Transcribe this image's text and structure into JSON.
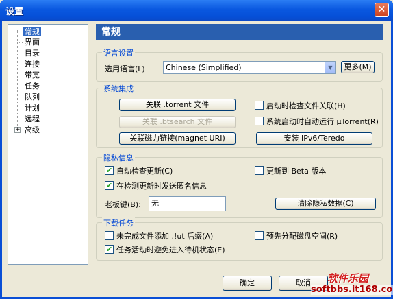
{
  "window": {
    "title": "设置",
    "close_glyph": "✕"
  },
  "sidebar": {
    "items": [
      {
        "label": "常规"
      },
      {
        "label": "界面"
      },
      {
        "label": "目录"
      },
      {
        "label": "连接"
      },
      {
        "label": "带宽"
      },
      {
        "label": "任务"
      },
      {
        "label": "队列"
      },
      {
        "label": "计划"
      },
      {
        "label": "远程"
      },
      {
        "label": "高级"
      }
    ],
    "expand_glyph": "+"
  },
  "page": {
    "title": "常规"
  },
  "language": {
    "group_title": "语言设置",
    "select_label": "选用语言(L)",
    "select_value": "Chinese (Simplified)",
    "more_button": "更多(M)"
  },
  "integration": {
    "group_title": "系统集成",
    "assoc_torrent": "关联 .torrent 文件",
    "assoc_btsearch": "关联 .btsearch 文件",
    "assoc_magnet": "关联磁力链接(magnet URI)",
    "check_assoc_label": "启动时检查文件关联(H)",
    "check_assoc_checked": false,
    "autostart_label": "系统启动时自动运行 µTorrent(R)",
    "autostart_checked": false,
    "install_ipv6": "安装 IPv6/Teredo"
  },
  "privacy": {
    "group_title": "隐私信息",
    "auto_update_label": "自动检查更新(C)",
    "auto_update_checked": true,
    "beta_label": "更新到 Beta 版本",
    "beta_checked": false,
    "anon_info_label": "在检测更新时发送匿名信息",
    "anon_info_checked": true,
    "boss_key_label": "老板键(B):",
    "boss_key_value": "无",
    "clear_privacy": "清除隐私数据(C)"
  },
  "download": {
    "group_title": "下载任务",
    "ut_ext_label": "未完成文件添加 .!ut 后缀(A)",
    "ut_ext_checked": false,
    "prealloc_label": "预先分配磁盘空间(R)",
    "prealloc_checked": false,
    "standby_label": "任务活动时避免进入待机状态(E)",
    "standby_checked": true
  },
  "footer": {
    "ok": "确定",
    "cancel": "取消"
  },
  "watermark": {
    "logo": "软件乐园",
    "url": "softbbs.it168.com"
  },
  "check_glyph": "✔"
}
